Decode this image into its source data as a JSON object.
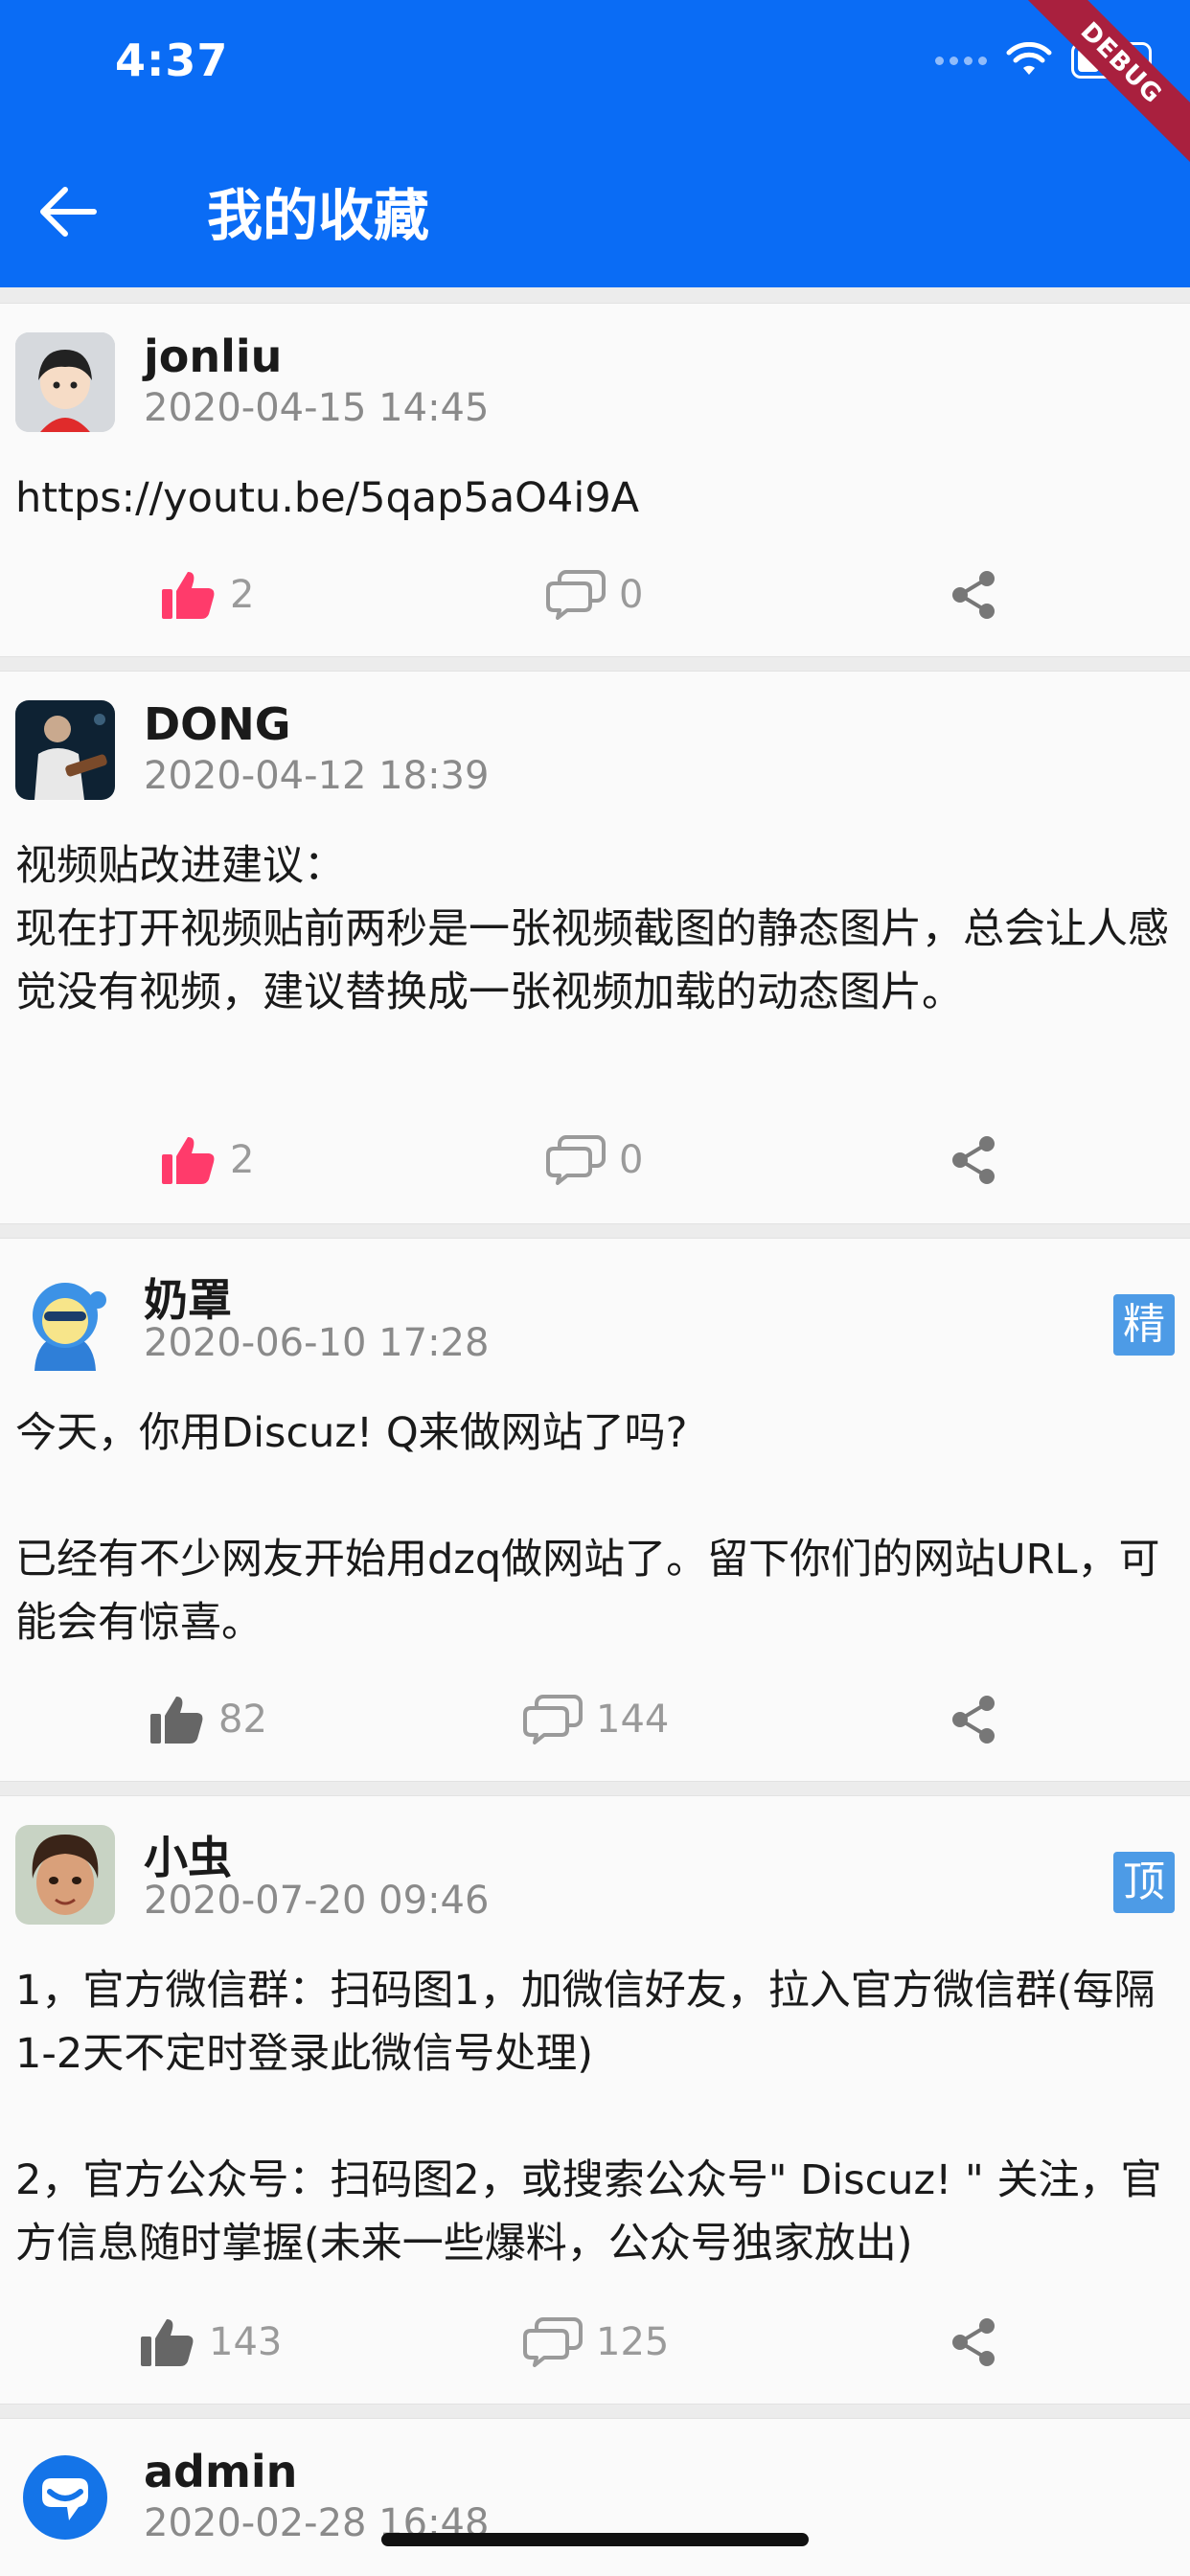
{
  "status_bar": {
    "time": "4:37",
    "debug_label": "DEBUG"
  },
  "header": {
    "title": "我的收藏",
    "background_color": "#0a6cf5"
  },
  "icons": {
    "back": "arrow-left-icon",
    "like": "thumbs-up-icon",
    "comment": "chat-bubbles-icon",
    "share": "share-icon"
  },
  "colors": {
    "liked": "#ff3b6b",
    "badge": "#4d9be6",
    "muted": "#8a8a8a"
  },
  "posts": [
    {
      "author": "jonliu",
      "date": "2020-04-15 14:45",
      "badge": "",
      "content": "https://youtu.be/5qap5aO4i9A",
      "likes": "2",
      "comments": "0",
      "liked": true
    },
    {
      "author": "DONG",
      "date": "2020-04-12 18:39",
      "badge": "",
      "content": "视频贴改进建议：\n现在打开视频贴前两秒是一张视频截图的静态图片，总会让人感觉没有视频，建议替换成一张视频加载的动态图片。",
      "likes": "2",
      "comments": "0",
      "liked": true
    },
    {
      "author": "奶罩",
      "date": "2020-06-10 17:28",
      "badge": "精",
      "content": "今天，你用Discuz! Q来做网站了吗?\n\n已经有不少网友开始用dzq做网站了。留下你们的网站URL，可能会有惊喜。",
      "likes": "82",
      "comments": "144",
      "liked": false
    },
    {
      "author": "小虫",
      "date": "2020-07-20 09:46",
      "badge": "顶",
      "content": "1，官方微信群：扫码图1，加微信好友，拉入官方微信群(每隔1-2天不定时登录此微信号处理)\n\n2，官方公众号：扫码图2，或搜索公众号\" Discuz! \" 关注，官方信息随时掌握(未来一些爆料，公众号独家放出)",
      "likes": "143",
      "comments": "125",
      "liked": false
    },
    {
      "author": "admin",
      "date": "2020-02-28 16:48"
    }
  ]
}
